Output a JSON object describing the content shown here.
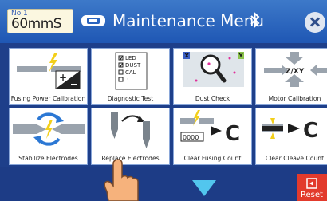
{
  "program": {
    "number_label": "No.1",
    "name": "60mmS"
  },
  "header": {
    "title": "Maintenance Menu"
  },
  "tiles": [
    {
      "label": "Fusing Power Calibration"
    },
    {
      "label": "Diagnostic Test",
      "checklist": [
        "LED",
        "DUST",
        "CAL",
        ":"
      ]
    },
    {
      "label": "Dust Check",
      "corner_x": "X",
      "corner_y": "Y"
    },
    {
      "label": "Motor Calibration",
      "axis_label": "Z/XY"
    },
    {
      "label": "Stabilize Electrodes"
    },
    {
      "label": "Replace Electrodes"
    },
    {
      "label": "Clear Fusing Count",
      "counter": "0000",
      "reset_glyph": "C"
    },
    {
      "label": "Clear Cleave Count",
      "reset_glyph": "C"
    }
  ],
  "footer": {
    "reset_label": "Reset"
  },
  "colors": {
    "header": "#2a64bf",
    "background": "#1e3f8a",
    "accent_arrow": "#52c6ee",
    "reset": "#e23a2c",
    "program_box": "#fbf7e0"
  }
}
